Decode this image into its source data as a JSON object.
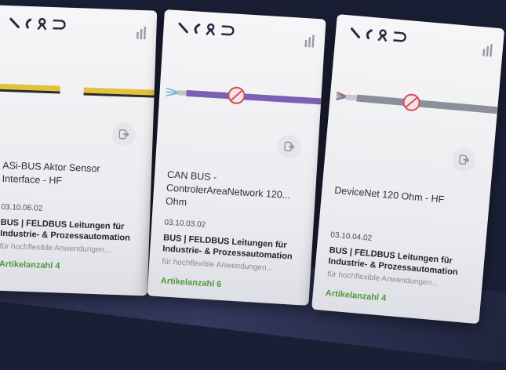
{
  "cards": [
    {
      "title": "ASi-BUS Aktor Sensor Interface - HF",
      "code": "03.10.06.02",
      "category": "BUS | FELDBUS Leitungen für Industrie- & Prozessautomation",
      "description": "für hochflexible Anwendungen...",
      "article_count": "Artikelanzahl 4",
      "cable_colors": [
        "#e2c23b",
        "#2a2a2a"
      ]
    },
    {
      "title": "CAN BUS - ControlerAreaNetwork 120... Ohm",
      "code": "03.10.03.02",
      "category": "BUS | FELDBUS Leitungen für Industrie- & Prozessautomation",
      "description": "für hochflexible Anwendungen...",
      "article_count": "Artikelanzahl 6",
      "cable_colors": [
        "#7b5fb5"
      ]
    },
    {
      "title": "DeviceNet 120 Ohm - HF",
      "code": "03.10.04.02",
      "category": "BUS | FELDBUS Leitungen für Industrie- & Prozessautomation",
      "description": "für hochflexible Anwendungen...",
      "article_count": "Artikelanzahl 4",
      "cable_colors": [
        "#8a8f9a"
      ]
    }
  ],
  "icons": [
    "bend-icon",
    "flex-icon",
    "drag-chain-icon",
    "torsion-icon",
    "bars-chart-icon",
    "share-icon",
    "no-halogen-badge-icon"
  ]
}
